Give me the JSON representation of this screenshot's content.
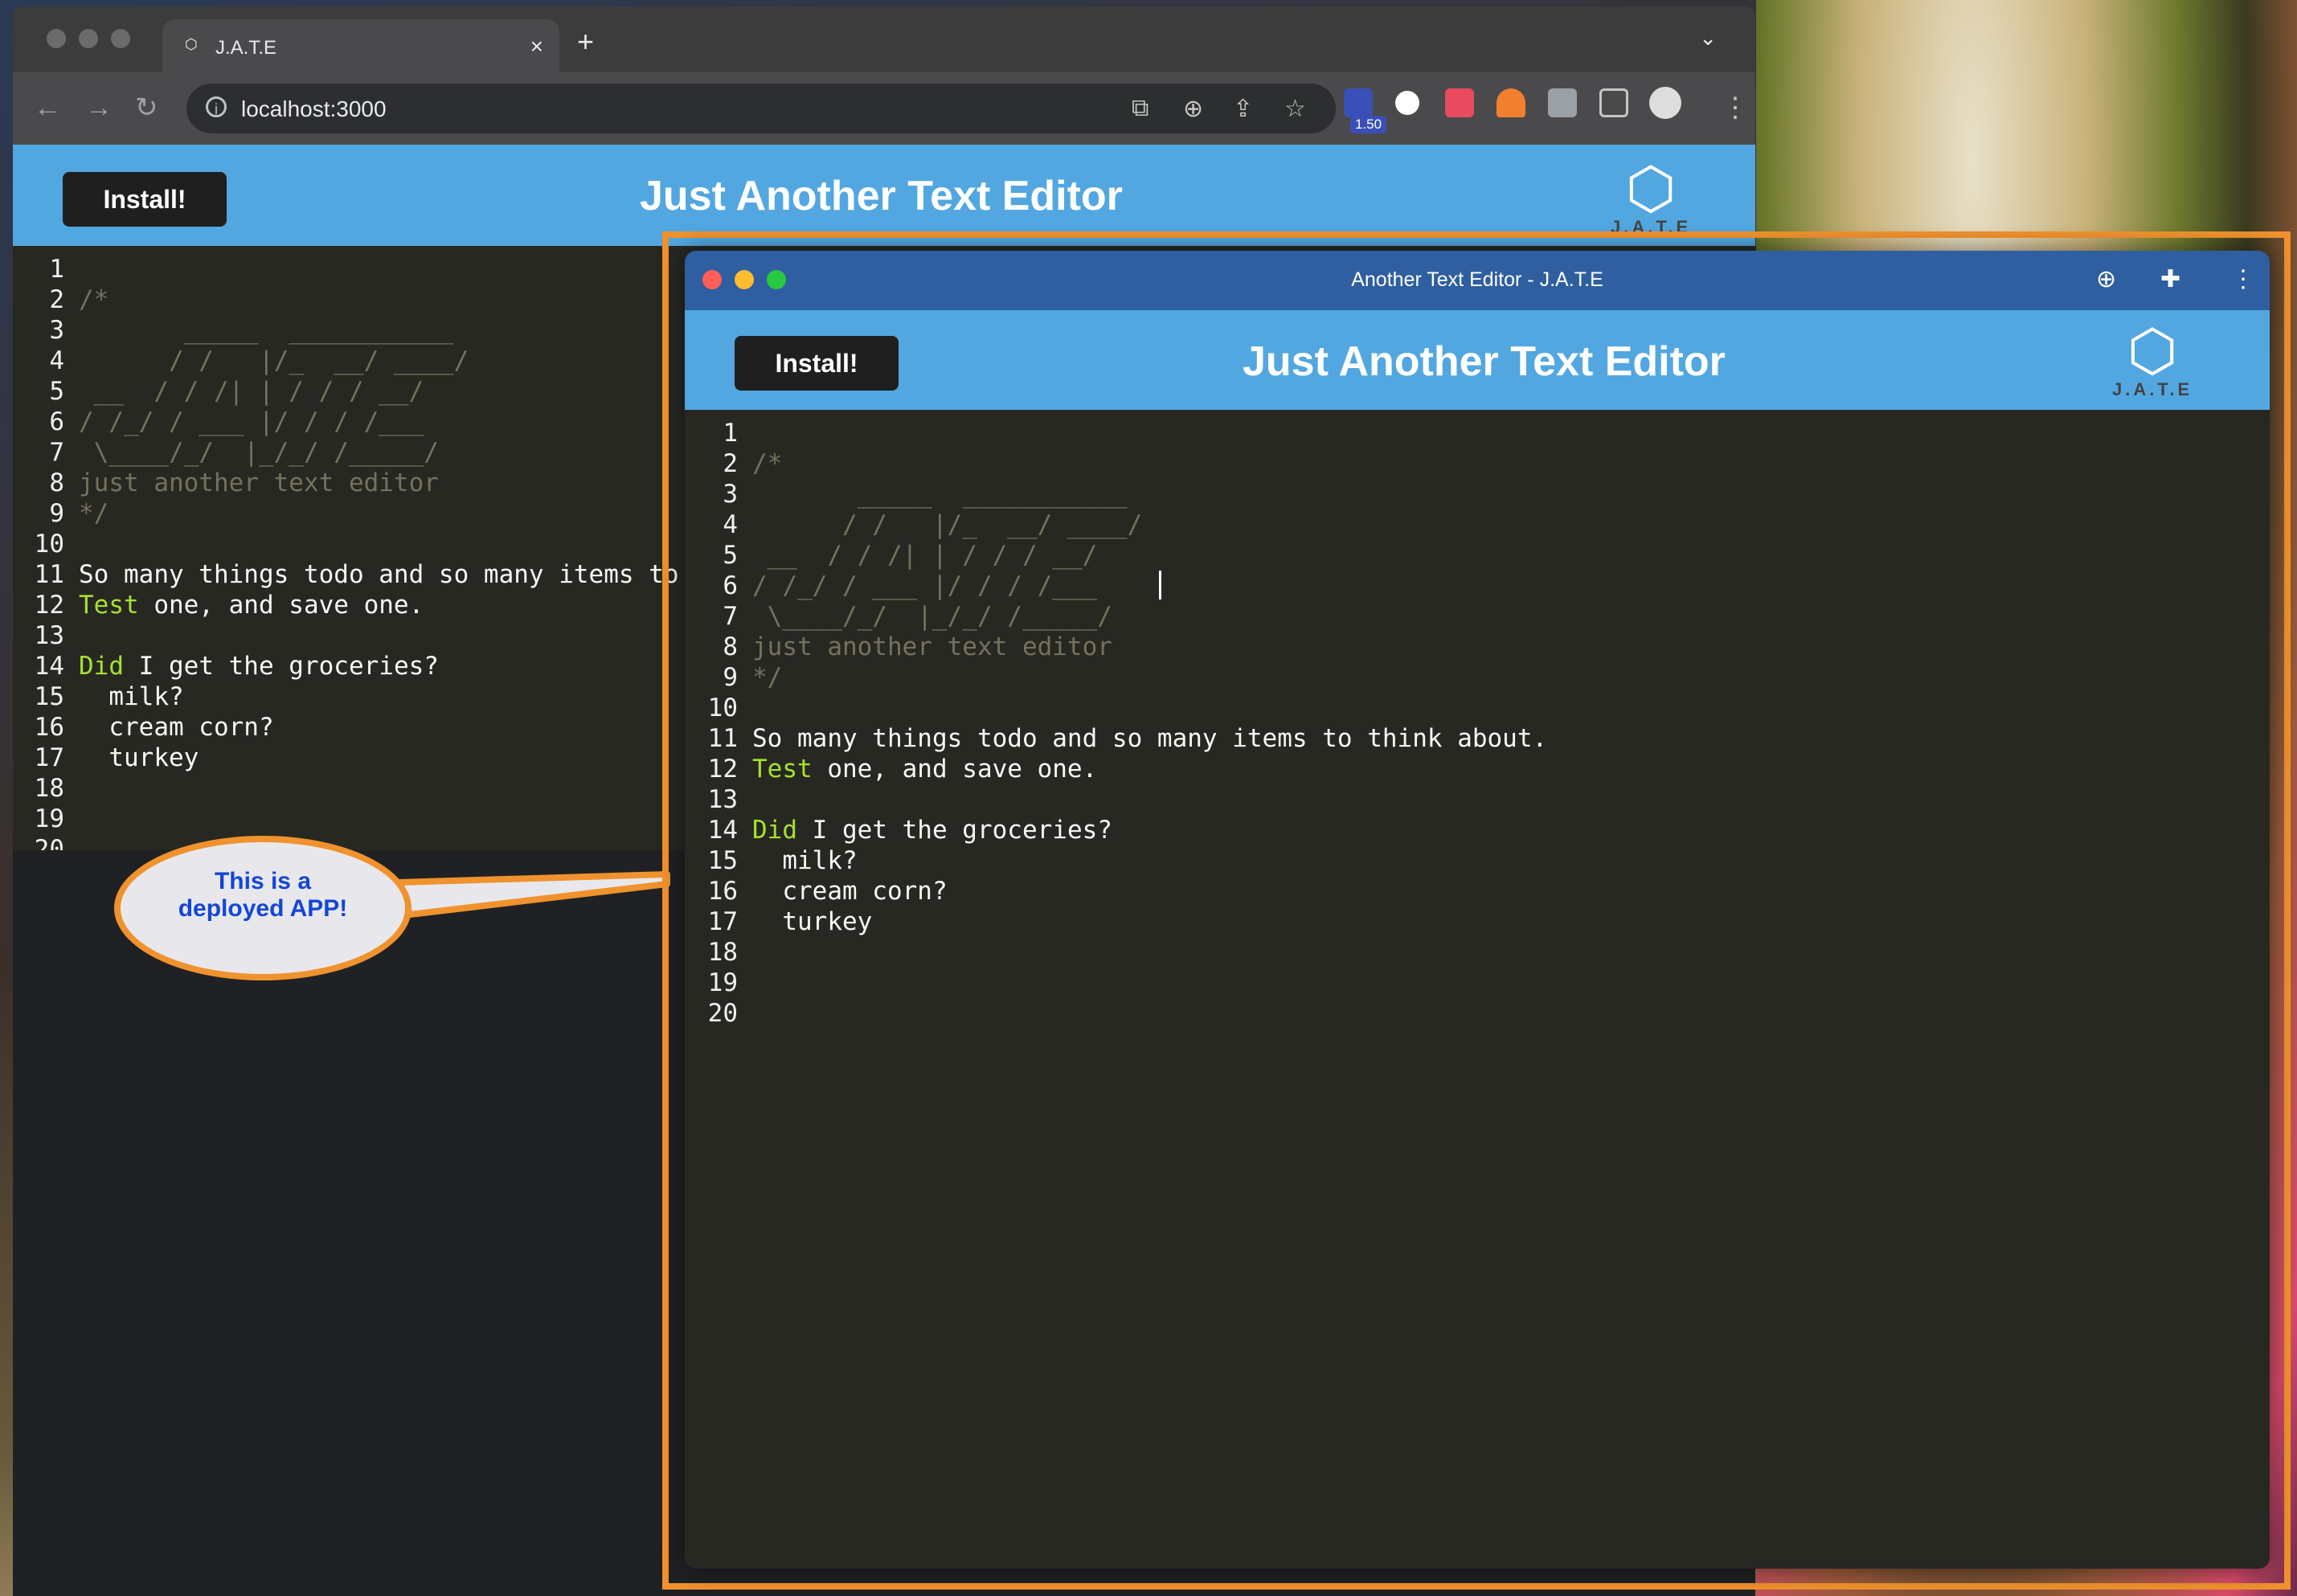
{
  "browser": {
    "tab_title": "J.A.T.E",
    "tab_close": "×",
    "new_tab": "+",
    "tab_menu": "⌄",
    "url": "localhost:3000",
    "nav": {
      "back": "←",
      "forward": "→",
      "reload": "↻"
    },
    "extension_badge": "1.50"
  },
  "app": {
    "install_label": "Install!",
    "title": "Just Another Text Editor",
    "logo_text": "J.A.T.E",
    "logo_glyph": "⬡"
  },
  "pwa_window": {
    "title": "Another Text Editor - J.A.T.E",
    "icons": [
      "zoom-icon",
      "puzzle-icon",
      "more-icon"
    ]
  },
  "callout": {
    "line1": "This is a",
    "line2": "deployed APP!"
  },
  "editor": {
    "lines": [
      {
        "n": "1",
        "parts": []
      },
      {
        "n": "2",
        "parts": [
          {
            "t": "/*",
            "c": "cm"
          }
        ]
      },
      {
        "n": "3",
        "parts": [
          {
            "t": "       _____  ___________",
            "c": "cm"
          }
        ]
      },
      {
        "n": "4",
        "parts": [
          {
            "t": "      / /   |/_  __/ ____/",
            "c": "cm"
          }
        ]
      },
      {
        "n": "5",
        "parts": [
          {
            "t": " __  / / /| | / / / __/",
            "c": "cm"
          }
        ]
      },
      {
        "n": "6",
        "parts": [
          {
            "t": "/ /_/ / ___ |/ / / /___",
            "c": "cm"
          }
        ]
      },
      {
        "n": "7",
        "parts": [
          {
            "t": " \\____/_/  |_/_/ /_____/",
            "c": "cm"
          }
        ]
      },
      {
        "n": "8",
        "parts": [
          {
            "t": "just another text editor",
            "c": "cm"
          }
        ]
      },
      {
        "n": "9",
        "parts": [
          {
            "t": "*/",
            "c": "cm"
          }
        ]
      },
      {
        "n": "10",
        "parts": []
      },
      {
        "n": "11",
        "parts": [
          {
            "t": "So many things todo and so many items to think about.",
            "c": ""
          }
        ]
      },
      {
        "n": "12",
        "parts": [
          {
            "t": "Test",
            "c": "kw"
          },
          {
            "t": " one, and save one.",
            "c": ""
          }
        ]
      },
      {
        "n": "13",
        "parts": []
      },
      {
        "n": "14",
        "parts": [
          {
            "t": "Did",
            "c": "kw"
          },
          {
            "t": " I get the groceries?",
            "c": ""
          }
        ]
      },
      {
        "n": "15",
        "parts": [
          {
            "t": "  milk?",
            "c": ""
          }
        ]
      },
      {
        "n": "16",
        "parts": [
          {
            "t": "  cream corn?",
            "c": ""
          }
        ]
      },
      {
        "n": "17",
        "parts": [
          {
            "t": "  turkey",
            "c": ""
          }
        ]
      },
      {
        "n": "18",
        "parts": []
      },
      {
        "n": "19",
        "parts": []
      },
      {
        "n": "20",
        "parts": []
      }
    ]
  },
  "colors": {
    "header_blue": "#52a7e0",
    "editor_bg": "#272822",
    "comment": "#75715e",
    "keyword": "#a6e22e",
    "callout_border": "#f0922e",
    "callout_text": "#1446d6"
  }
}
